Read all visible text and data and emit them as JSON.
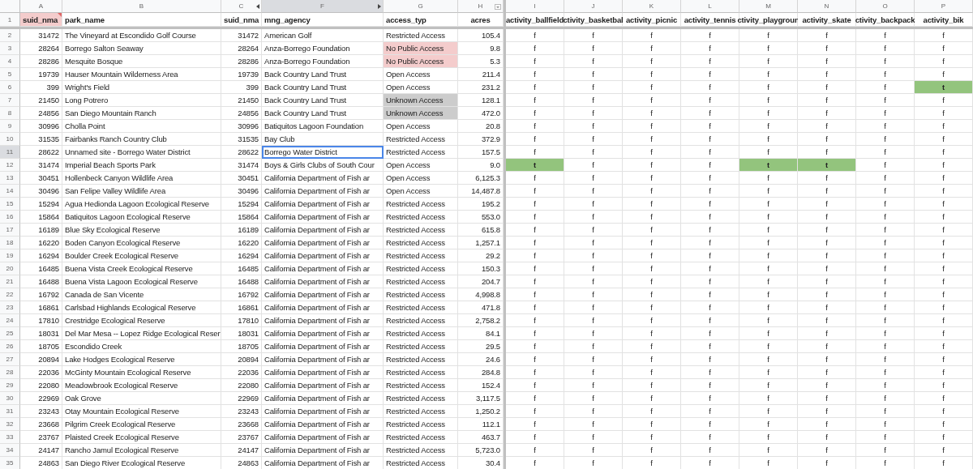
{
  "header_row_number": "1",
  "columns": [
    {
      "letter": "A",
      "heading": "suid_nma",
      "selected": false,
      "note": true,
      "color": "#f4cccc",
      "hidden_after": false,
      "hidden_before": false,
      "filter": false
    },
    {
      "letter": "B",
      "heading": "park_name",
      "selected": false,
      "note": false,
      "hidden_after": false,
      "hidden_before": false,
      "filter": false
    },
    {
      "letter": "C",
      "heading": "suid_nma",
      "selected": false,
      "note": false,
      "hidden_after": true,
      "hidden_before": false,
      "filter": false
    },
    {
      "letter": "F",
      "heading": "mng_agency",
      "selected": true,
      "note": false,
      "hidden_after": false,
      "hidden_before": true,
      "filter": false
    },
    {
      "letter": "G",
      "heading": "access_typ",
      "selected": false,
      "note": false,
      "hidden_after": false,
      "hidden_before": false,
      "filter": false
    },
    {
      "letter": "H",
      "heading": "acres",
      "selected": false,
      "note": false,
      "hidden_after": false,
      "hidden_before": false,
      "filter": true
    }
  ],
  "activity_columns": [
    {
      "letter": "I",
      "heading": "activity_ballfield"
    },
    {
      "letter": "J",
      "heading": "ctivity_basketbal"
    },
    {
      "letter": "K",
      "heading": "activity_picnic"
    },
    {
      "letter": "L",
      "heading": "activity_tennis"
    },
    {
      "letter": "M",
      "heading": "ctivity_playgroun"
    },
    {
      "letter": "N",
      "heading": "activity_skate"
    },
    {
      "letter": "O",
      "heading": "ctivity_backpack"
    },
    {
      "letter": "P",
      "heading": "activity_bik"
    }
  ],
  "rows": [
    {
      "number": "2",
      "selected": false,
      "cells": [
        "31472",
        "The Vineyard at Escondido Golf Course",
        "31472",
        "American Golf"
      ],
      "access": {
        "text": "Restricted Access"
      },
      "acres": "105.4",
      "activities": [
        {
          "v": "f"
        },
        {
          "v": "f"
        },
        {
          "v": "f"
        },
        {
          "v": "f"
        },
        {
          "v": "f"
        },
        {
          "v": "f"
        },
        {
          "v": "f"
        },
        {
          "v": "f"
        }
      ]
    },
    {
      "number": "3",
      "selected": false,
      "cells": [
        "28264",
        "Borrego Salton Seaway",
        "28264",
        "Anza-Borrego Foundation"
      ],
      "access": {
        "text": "No Public Access",
        "color": "#f4cccc"
      },
      "acres": "9.8",
      "activities": [
        {
          "v": "f"
        },
        {
          "v": "f"
        },
        {
          "v": "f"
        },
        {
          "v": "f"
        },
        {
          "v": "f"
        },
        {
          "v": "f"
        },
        {
          "v": "f"
        },
        {
          "v": "f"
        }
      ]
    },
    {
      "number": "4",
      "selected": false,
      "cells": [
        "28286",
        "Mesquite Bosque",
        "28286",
        "Anza-Borrego Foundation"
      ],
      "access": {
        "text": "No Public Access",
        "color": "#f4cccc"
      },
      "acres": "5.3",
      "activities": [
        {
          "v": "f"
        },
        {
          "v": "f"
        },
        {
          "v": "f"
        },
        {
          "v": "f"
        },
        {
          "v": "f"
        },
        {
          "v": "f"
        },
        {
          "v": "f"
        },
        {
          "v": "f"
        }
      ]
    },
    {
      "number": "5",
      "selected": false,
      "cells": [
        "19739",
        "Hauser Mountain Wilderness Area",
        "19739",
        "Back Country Land Trust"
      ],
      "access": {
        "text": "Open Access"
      },
      "acres": "211.4",
      "activities": [
        {
          "v": "f"
        },
        {
          "v": "f"
        },
        {
          "v": "f"
        },
        {
          "v": "f"
        },
        {
          "v": "f"
        },
        {
          "v": "f"
        },
        {
          "v": "f"
        },
        {
          "v": "f"
        }
      ]
    },
    {
      "number": "6",
      "selected": false,
      "cells": [
        "399",
        "Wright's Field",
        "399",
        "Back Country Land Trust"
      ],
      "access": {
        "text": "Open Access"
      },
      "acres": "231.2",
      "activities": [
        {
          "v": "f"
        },
        {
          "v": "f"
        },
        {
          "v": "f"
        },
        {
          "v": "f"
        },
        {
          "v": "f"
        },
        {
          "v": "f"
        },
        {
          "v": "f"
        },
        {
          "v": "t",
          "color": "#93c47d"
        }
      ]
    },
    {
      "number": "7",
      "selected": false,
      "cells": [
        "21450",
        "Long Potrero",
        "21450",
        "Back Country Land Trust"
      ],
      "access": {
        "text": "Unknown Access",
        "color": "#cccccc"
      },
      "acres": "128.1",
      "activities": [
        {
          "v": "f"
        },
        {
          "v": "f"
        },
        {
          "v": "f"
        },
        {
          "v": "f"
        },
        {
          "v": "f"
        },
        {
          "v": "f"
        },
        {
          "v": "f"
        },
        {
          "v": "f"
        }
      ]
    },
    {
      "number": "8",
      "selected": false,
      "cells": [
        "24856",
        "San Diego Mountain Ranch",
        "24856",
        "Back Country Land Trust"
      ],
      "access": {
        "text": "Unknown Access",
        "color": "#cccccc"
      },
      "acres": "472.0",
      "activities": [
        {
          "v": "f"
        },
        {
          "v": "f"
        },
        {
          "v": "f"
        },
        {
          "v": "f"
        },
        {
          "v": "f"
        },
        {
          "v": "f"
        },
        {
          "v": "f"
        },
        {
          "v": "f"
        }
      ]
    },
    {
      "number": "9",
      "selected": false,
      "cells": [
        "30996",
        "Cholla Point",
        "30996",
        "Batiquitos Lagoon Foundation"
      ],
      "access": {
        "text": "Open Access"
      },
      "acres": "20.8",
      "activities": [
        {
          "v": "f"
        },
        {
          "v": "f"
        },
        {
          "v": "f"
        },
        {
          "v": "f"
        },
        {
          "v": "f"
        },
        {
          "v": "f"
        },
        {
          "v": "f"
        },
        {
          "v": "f"
        }
      ]
    },
    {
      "number": "10",
      "selected": false,
      "cells": [
        "31535",
        "Fairbanks Ranch Country Club",
        "31535",
        "Bay Club"
      ],
      "access": {
        "text": "Restricted Access"
      },
      "acres": "372.9",
      "activities": [
        {
          "v": "f"
        },
        {
          "v": "f"
        },
        {
          "v": "f"
        },
        {
          "v": "f"
        },
        {
          "v": "f"
        },
        {
          "v": "f"
        },
        {
          "v": "f"
        },
        {
          "v": "f"
        }
      ]
    },
    {
      "number": "11",
      "selected": true,
      "cells": [
        "28622",
        "Unnamed site - Borrego Water District",
        "28622",
        "Borrego Water District"
      ],
      "access": {
        "text": "Restricted Access"
      },
      "acres": "157.5",
      "activities": [
        {
          "v": "f"
        },
        {
          "v": "f"
        },
        {
          "v": "f"
        },
        {
          "v": "f"
        },
        {
          "v": "f"
        },
        {
          "v": "f"
        },
        {
          "v": "f"
        },
        {
          "v": "f"
        }
      ]
    },
    {
      "number": "12",
      "selected": false,
      "cells": [
        "31474",
        "Imperial Beach Sports Park",
        "31474",
        "Boys & Girls Clubs of South Cour"
      ],
      "access": {
        "text": "Open Access"
      },
      "acres": "9.0",
      "activities": [
        {
          "v": "t",
          "color": "#93c47d"
        },
        {
          "v": "f"
        },
        {
          "v": "f"
        },
        {
          "v": "f"
        },
        {
          "v": "t",
          "color": "#93c47d"
        },
        {
          "v": "t",
          "color": "#93c47d"
        },
        {
          "v": "f"
        },
        {
          "v": "f"
        }
      ]
    },
    {
      "number": "13",
      "selected": false,
      "cells": [
        "30451",
        "Hollenbeck Canyon Wildlife Area",
        "30451",
        "California Department of Fish ar"
      ],
      "access": {
        "text": "Open Access"
      },
      "acres": "6,125.3",
      "activities": [
        {
          "v": "f"
        },
        {
          "v": "f"
        },
        {
          "v": "f"
        },
        {
          "v": "f"
        },
        {
          "v": "f"
        },
        {
          "v": "f"
        },
        {
          "v": "f"
        },
        {
          "v": "f"
        }
      ]
    },
    {
      "number": "14",
      "selected": false,
      "cells": [
        "30496",
        "San Felipe Valley Wildlife Area",
        "30496",
        "California Department of Fish ar"
      ],
      "access": {
        "text": "Open Access"
      },
      "acres": "14,487.8",
      "activities": [
        {
          "v": "f"
        },
        {
          "v": "f"
        },
        {
          "v": "f"
        },
        {
          "v": "f"
        },
        {
          "v": "f"
        },
        {
          "v": "f"
        },
        {
          "v": "f"
        },
        {
          "v": "f"
        }
      ]
    },
    {
      "number": "15",
      "selected": false,
      "cells": [
        "15294",
        "Agua Hedionda Lagoon Ecological Reserve",
        "15294",
        "California Department of Fish ar"
      ],
      "access": {
        "text": "Restricted Access"
      },
      "acres": "195.2",
      "activities": [
        {
          "v": "f"
        },
        {
          "v": "f"
        },
        {
          "v": "f"
        },
        {
          "v": "f"
        },
        {
          "v": "f"
        },
        {
          "v": "f"
        },
        {
          "v": "f"
        },
        {
          "v": "f"
        }
      ]
    },
    {
      "number": "16",
      "selected": false,
      "cells": [
        "15864",
        "Batiquitos Lagoon Ecological Reserve",
        "15864",
        "California Department of Fish ar"
      ],
      "access": {
        "text": "Restricted Access"
      },
      "acres": "553.0",
      "activities": [
        {
          "v": "f"
        },
        {
          "v": "f"
        },
        {
          "v": "f"
        },
        {
          "v": "f"
        },
        {
          "v": "f"
        },
        {
          "v": "f"
        },
        {
          "v": "f"
        },
        {
          "v": "f"
        }
      ]
    },
    {
      "number": "17",
      "selected": false,
      "cells": [
        "16189",
        "Blue Sky Ecological Reserve",
        "16189",
        "California Department of Fish ar"
      ],
      "access": {
        "text": "Restricted Access"
      },
      "acres": "615.8",
      "activities": [
        {
          "v": "f"
        },
        {
          "v": "f"
        },
        {
          "v": "f"
        },
        {
          "v": "f"
        },
        {
          "v": "f"
        },
        {
          "v": "f"
        },
        {
          "v": "f"
        },
        {
          "v": "f"
        }
      ]
    },
    {
      "number": "18",
      "selected": false,
      "cells": [
        "16220",
        "Boden Canyon Ecological Reserve",
        "16220",
        "California Department of Fish ar"
      ],
      "access": {
        "text": "Restricted Access"
      },
      "acres": "1,257.1",
      "activities": [
        {
          "v": "f"
        },
        {
          "v": "f"
        },
        {
          "v": "f"
        },
        {
          "v": "f"
        },
        {
          "v": "f"
        },
        {
          "v": "f"
        },
        {
          "v": "f"
        },
        {
          "v": "f"
        }
      ]
    },
    {
      "number": "19",
      "selected": false,
      "cells": [
        "16294",
        "Boulder Creek Ecological Reserve",
        "16294",
        "California Department of Fish ar"
      ],
      "access": {
        "text": "Restricted Access"
      },
      "acres": "29.2",
      "activities": [
        {
          "v": "f"
        },
        {
          "v": "f"
        },
        {
          "v": "f"
        },
        {
          "v": "f"
        },
        {
          "v": "f"
        },
        {
          "v": "f"
        },
        {
          "v": "f"
        },
        {
          "v": "f"
        }
      ]
    },
    {
      "number": "20",
      "selected": false,
      "cells": [
        "16485",
        "Buena Vista Creek Ecological Reserve",
        "16485",
        "California Department of Fish ar"
      ],
      "access": {
        "text": "Restricted Access"
      },
      "acres": "150.3",
      "activities": [
        {
          "v": "f"
        },
        {
          "v": "f"
        },
        {
          "v": "f"
        },
        {
          "v": "f"
        },
        {
          "v": "f"
        },
        {
          "v": "f"
        },
        {
          "v": "f"
        },
        {
          "v": "f"
        }
      ]
    },
    {
      "number": "21",
      "selected": false,
      "cells": [
        "16488",
        "Buena Vista Lagoon Ecological Reserve",
        "16488",
        "California Department of Fish ar"
      ],
      "access": {
        "text": "Restricted Access"
      },
      "acres": "204.7",
      "activities": [
        {
          "v": "f"
        },
        {
          "v": "f"
        },
        {
          "v": "f"
        },
        {
          "v": "f"
        },
        {
          "v": "f"
        },
        {
          "v": "f"
        },
        {
          "v": "f"
        },
        {
          "v": "f"
        }
      ]
    },
    {
      "number": "22",
      "selected": false,
      "cells": [
        "16792",
        "Canada de San Vicente",
        "16792",
        "California Department of Fish ar"
      ],
      "access": {
        "text": "Restricted Access"
      },
      "acres": "4,998.8",
      "activities": [
        {
          "v": "f"
        },
        {
          "v": "f"
        },
        {
          "v": "f"
        },
        {
          "v": "f"
        },
        {
          "v": "f"
        },
        {
          "v": "f"
        },
        {
          "v": "f"
        },
        {
          "v": "f"
        }
      ]
    },
    {
      "number": "23",
      "selected": false,
      "cells": [
        "16861",
        "Carlsbad Highlands Ecological Reserve",
        "16861",
        "California Department of Fish ar"
      ],
      "access": {
        "text": "Restricted Access"
      },
      "acres": "471.8",
      "activities": [
        {
          "v": "f"
        },
        {
          "v": "f"
        },
        {
          "v": "f"
        },
        {
          "v": "f"
        },
        {
          "v": "f"
        },
        {
          "v": "f"
        },
        {
          "v": "f"
        },
        {
          "v": "f"
        }
      ]
    },
    {
      "number": "24",
      "selected": false,
      "cells": [
        "17810",
        "Crestridge Ecological Reserve",
        "17810",
        "California Department of Fish ar"
      ],
      "access": {
        "text": "Restricted Access"
      },
      "acres": "2,758.2",
      "activities": [
        {
          "v": "f"
        },
        {
          "v": "f"
        },
        {
          "v": "f"
        },
        {
          "v": "f"
        },
        {
          "v": "f"
        },
        {
          "v": "f"
        },
        {
          "v": "f"
        },
        {
          "v": "f"
        }
      ]
    },
    {
      "number": "25",
      "selected": false,
      "cells": [
        "18031",
        "Del Mar Mesa -- Lopez Ridge Ecological Reser",
        "18031",
        "California Department of Fish ar"
      ],
      "access": {
        "text": "Restricted Access"
      },
      "acres": "84.1",
      "activities": [
        {
          "v": "f"
        },
        {
          "v": "f"
        },
        {
          "v": "f"
        },
        {
          "v": "f"
        },
        {
          "v": "f"
        },
        {
          "v": "f"
        },
        {
          "v": "f"
        },
        {
          "v": "f"
        }
      ]
    },
    {
      "number": "26",
      "selected": false,
      "cells": [
        "18705",
        "Escondido Creek",
        "18705",
        "California Department of Fish ar"
      ],
      "access": {
        "text": "Restricted Access"
      },
      "acres": "29.5",
      "activities": [
        {
          "v": "f"
        },
        {
          "v": "f"
        },
        {
          "v": "f"
        },
        {
          "v": "f"
        },
        {
          "v": "f"
        },
        {
          "v": "f"
        },
        {
          "v": "f"
        },
        {
          "v": "f"
        }
      ]
    },
    {
      "number": "27",
      "selected": false,
      "cells": [
        "20894",
        "Lake Hodges Ecological Reserve",
        "20894",
        "California Department of Fish ar"
      ],
      "access": {
        "text": "Restricted Access"
      },
      "acres": "24.6",
      "activities": [
        {
          "v": "f"
        },
        {
          "v": "f"
        },
        {
          "v": "f"
        },
        {
          "v": "f"
        },
        {
          "v": "f"
        },
        {
          "v": "f"
        },
        {
          "v": "f"
        },
        {
          "v": "f"
        }
      ]
    },
    {
      "number": "28",
      "selected": false,
      "cells": [
        "22036",
        "McGinty Mountain Ecological Reserve",
        "22036",
        "California Department of Fish ar"
      ],
      "access": {
        "text": "Restricted Access"
      },
      "acres": "284.8",
      "activities": [
        {
          "v": "f"
        },
        {
          "v": "f"
        },
        {
          "v": "f"
        },
        {
          "v": "f"
        },
        {
          "v": "f"
        },
        {
          "v": "f"
        },
        {
          "v": "f"
        },
        {
          "v": "f"
        }
      ]
    },
    {
      "number": "29",
      "selected": false,
      "cells": [
        "22080",
        "Meadowbrook Ecological Reserve",
        "22080",
        "California Department of Fish ar"
      ],
      "access": {
        "text": "Restricted Access"
      },
      "acres": "152.4",
      "activities": [
        {
          "v": "f"
        },
        {
          "v": "f"
        },
        {
          "v": "f"
        },
        {
          "v": "f"
        },
        {
          "v": "f"
        },
        {
          "v": "f"
        },
        {
          "v": "f"
        },
        {
          "v": "f"
        }
      ]
    },
    {
      "number": "30",
      "selected": false,
      "cells": [
        "22969",
        "Oak Grove",
        "22969",
        "California Department of Fish ar"
      ],
      "access": {
        "text": "Restricted Access"
      },
      "acres": "3,117.5",
      "activities": [
        {
          "v": "f"
        },
        {
          "v": "f"
        },
        {
          "v": "f"
        },
        {
          "v": "f"
        },
        {
          "v": "f"
        },
        {
          "v": "f"
        },
        {
          "v": "f"
        },
        {
          "v": "f"
        }
      ]
    },
    {
      "number": "31",
      "selected": false,
      "cells": [
        "23243",
        "Otay Mountain Ecological Reserve",
        "23243",
        "California Department of Fish ar"
      ],
      "access": {
        "text": "Restricted Access"
      },
      "acres": "1,250.2",
      "activities": [
        {
          "v": "f"
        },
        {
          "v": "f"
        },
        {
          "v": "f"
        },
        {
          "v": "f"
        },
        {
          "v": "f"
        },
        {
          "v": "f"
        },
        {
          "v": "f"
        },
        {
          "v": "f"
        }
      ]
    },
    {
      "number": "32",
      "selected": false,
      "cells": [
        "23668",
        "Pilgrim Creek Ecological Reserve",
        "23668",
        "California Department of Fish ar"
      ],
      "access": {
        "text": "Restricted Access"
      },
      "acres": "112.1",
      "activities": [
        {
          "v": "f"
        },
        {
          "v": "f"
        },
        {
          "v": "f"
        },
        {
          "v": "f"
        },
        {
          "v": "f"
        },
        {
          "v": "f"
        },
        {
          "v": "f"
        },
        {
          "v": "f"
        }
      ]
    },
    {
      "number": "33",
      "selected": false,
      "cells": [
        "23767",
        "Plaisted Creek Ecological Reserve",
        "23767",
        "California Department of Fish ar"
      ],
      "access": {
        "text": "Restricted Access"
      },
      "acres": "463.7",
      "activities": [
        {
          "v": "f"
        },
        {
          "v": "f"
        },
        {
          "v": "f"
        },
        {
          "v": "f"
        },
        {
          "v": "f"
        },
        {
          "v": "f"
        },
        {
          "v": "f"
        },
        {
          "v": "f"
        }
      ]
    },
    {
      "number": "34",
      "selected": false,
      "cells": [
        "24147",
        "Rancho Jamul Ecological Reserve",
        "24147",
        "California Department of Fish ar"
      ],
      "access": {
        "text": "Restricted Access"
      },
      "acres": "5,723.0",
      "activities": [
        {
          "v": "f"
        },
        {
          "v": "f"
        },
        {
          "v": "f"
        },
        {
          "v": "f"
        },
        {
          "v": "f"
        },
        {
          "v": "f"
        },
        {
          "v": "f"
        },
        {
          "v": "f"
        }
      ]
    },
    {
      "number": "35",
      "selected": false,
      "cells": [
        "24863",
        "San Diego River Ecological Reserve",
        "24863",
        "California Department of Fish ar"
      ],
      "access": {
        "text": "Restricted Access"
      },
      "acres": "30.4",
      "activities": [
        {
          "v": "f"
        },
        {
          "v": "f"
        },
        {
          "v": "f"
        },
        {
          "v": "f"
        },
        {
          "v": "f"
        },
        {
          "v": "f"
        },
        {
          "v": "f"
        },
        {
          "v": "f"
        }
      ]
    }
  ]
}
